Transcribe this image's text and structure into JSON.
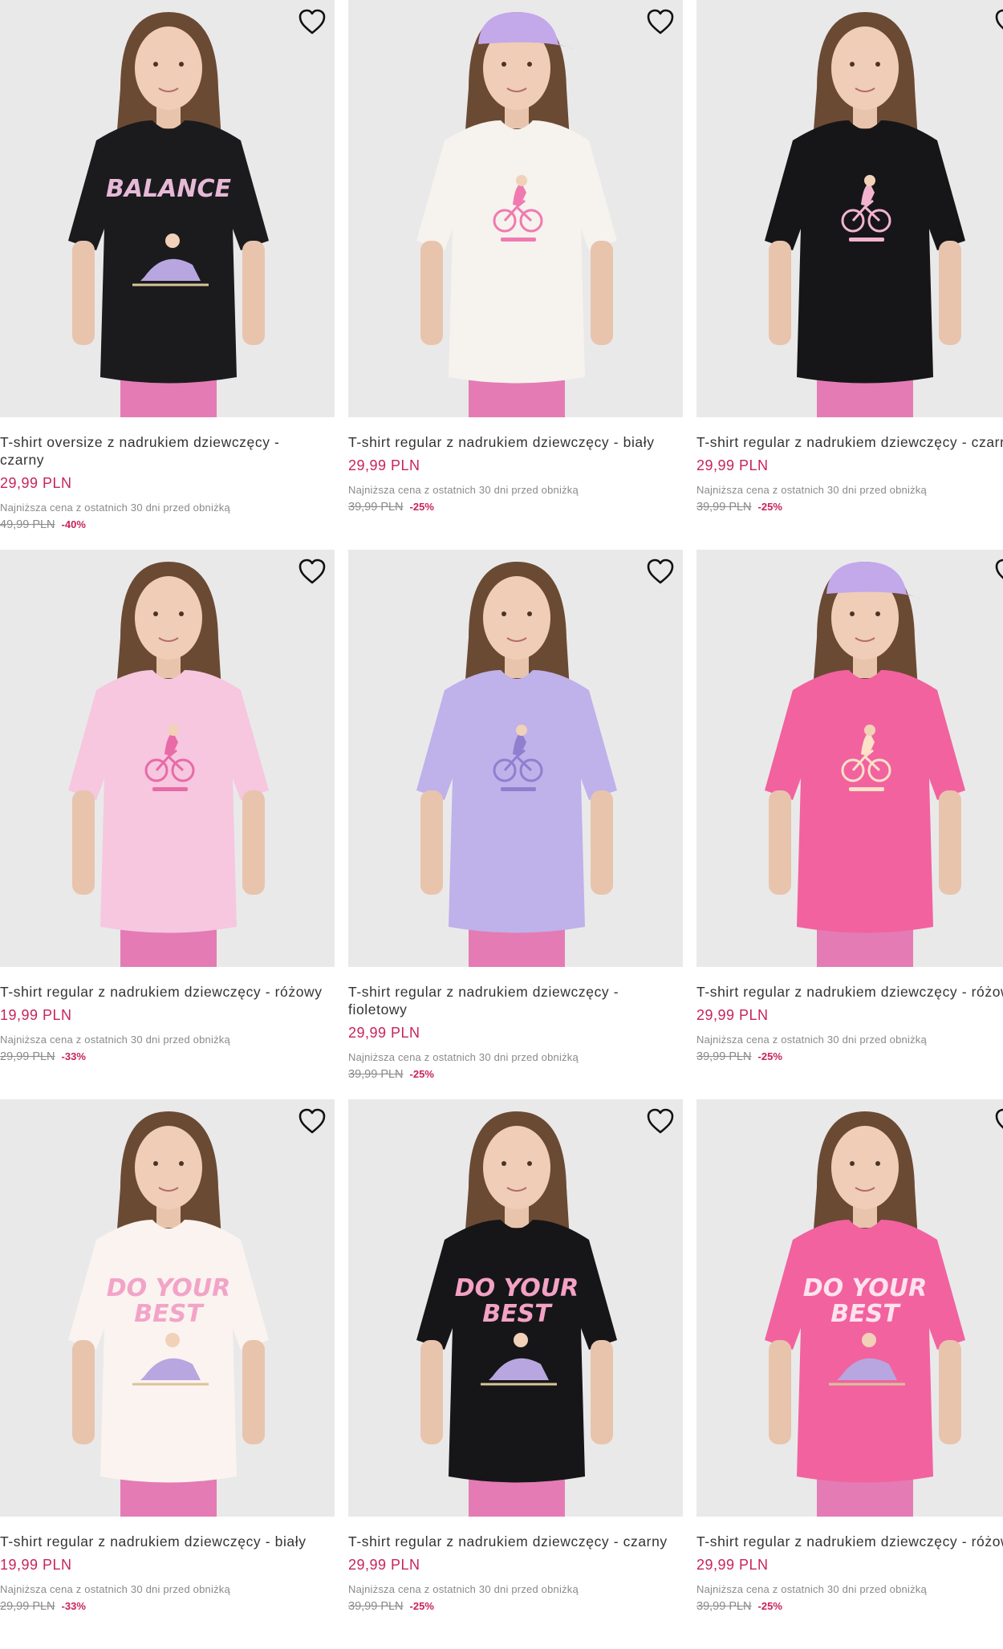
{
  "products": [
    {
      "title": "T-shirt oversize z nadrukiem dziewczęcy - czarny",
      "price": "29,99 PLN",
      "lowest_label": "Najniższa cena z ostatnich 30 dni przed obniżką",
      "old_price": "49,99 PLN",
      "discount": "-40%",
      "shirt_color": "#1b1b1d",
      "print_color": "#e6b9d6",
      "print_text": "BALANCE",
      "has_cap": false,
      "cap_color": ""
    },
    {
      "title": "T-shirt regular z nadrukiem dziewczęcy - biały",
      "price": "29,99 PLN",
      "lowest_label": "Najniższa cena z ostatnich 30 dni przed obniżką",
      "old_price": "39,99 PLN",
      "discount": "-25%",
      "shirt_color": "#f6f2ee",
      "print_color": "#f07ab0",
      "print_text": "",
      "has_cap": true,
      "cap_color": "#c3a8ea"
    },
    {
      "title": "T-shirt regular z nadrukiem dziewczęcy - czarny",
      "price": "29,99 PLN",
      "lowest_label": "Najniższa cena z ostatnich 30 dni przed obniżką",
      "old_price": "39,99 PLN",
      "discount": "-25%",
      "shirt_color": "#161618",
      "print_color": "#f3b3cf",
      "print_text": "",
      "has_cap": false,
      "cap_color": ""
    },
    {
      "title": "T-shirt regular z nadrukiem dziewczęcy - różowy",
      "price": "19,99 PLN",
      "lowest_label": "Najniższa cena z ostatnich 30 dni przed obniżką",
      "old_price": "29,99 PLN",
      "discount": "-33%",
      "shirt_color": "#f6c7df",
      "print_color": "#e86aa7",
      "print_text": "",
      "has_cap": false,
      "cap_color": ""
    },
    {
      "title": "T-shirt regular z nadrukiem dziewczęcy - fioletowy",
      "price": "29,99 PLN",
      "lowest_label": "Najniższa cena z ostatnich 30 dni przed obniżką",
      "old_price": "39,99 PLN",
      "discount": "-25%",
      "shirt_color": "#bfb1ea",
      "print_color": "#8f7fcf",
      "print_text": "",
      "has_cap": false,
      "cap_color": ""
    },
    {
      "title": "T-shirt regular z nadrukiem dziewczęcy - różowy",
      "price": "29,99 PLN",
      "lowest_label": "Najniższa cena z ostatnich 30 dni przed obniżką",
      "old_price": "39,99 PLN",
      "discount": "-25%",
      "shirt_color": "#f2629f",
      "print_color": "#fbe2c9",
      "print_text": "",
      "has_cap": true,
      "cap_color": "#c3a8ea"
    },
    {
      "title": "T-shirt regular z nadrukiem dziewczęcy - biały",
      "price": "19,99 PLN",
      "lowest_label": "Najniższa cena z ostatnich 30 dni przed obniżką",
      "old_price": "29,99 PLN",
      "discount": "-33%",
      "shirt_color": "#fbf3ef",
      "print_color": "#f2a4c8",
      "print_text": "DO YOUR BEST",
      "has_cap": false,
      "cap_color": ""
    },
    {
      "title": "T-shirt regular z nadrukiem dziewczęcy - czarny",
      "price": "29,99 PLN",
      "lowest_label": "Najniższa cena z ostatnich 30 dni przed obniżką",
      "old_price": "39,99 PLN",
      "discount": "-25%",
      "shirt_color": "#161618",
      "print_color": "#f3a1c5",
      "print_text": "DO YOUR BEST",
      "has_cap": false,
      "cap_color": ""
    },
    {
      "title": "T-shirt regular z nadrukiem dziewczęcy - różowy",
      "price": "29,99 PLN",
      "lowest_label": "Najniższa cena z ostatnich 30 dni przed obniżką",
      "old_price": "39,99 PLN",
      "discount": "-25%",
      "shirt_color": "#f2629f",
      "print_color": "#fde3ee",
      "print_text": "DO YOUR BEST",
      "has_cap": false,
      "cap_color": ""
    }
  ],
  "colors": {
    "price": "#c8235a",
    "discount": "#c8235a",
    "muted": "#8a8a8a",
    "image_bg": "#e9e9ea"
  },
  "icons": {
    "favorite": "heart-outline-icon"
  }
}
